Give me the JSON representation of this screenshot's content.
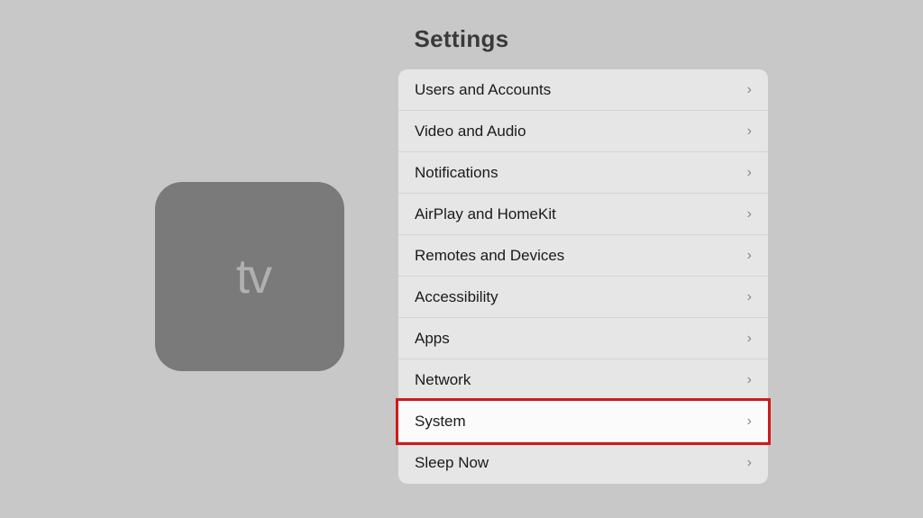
{
  "page": {
    "title": "Settings"
  },
  "device": {
    "label": "Apple TV",
    "apple_symbol": "",
    "tv_text": "tv"
  },
  "menu": {
    "items": [
      {
        "id": "users-and-accounts",
        "label": "Users and Accounts",
        "selected": false
      },
      {
        "id": "video-and-audio",
        "label": "Video and Audio",
        "selected": false
      },
      {
        "id": "notifications",
        "label": "Notifications",
        "selected": false
      },
      {
        "id": "airplay-and-homekit",
        "label": "AirPlay and HomeKit",
        "selected": false
      },
      {
        "id": "remotes-and-devices",
        "label": "Remotes and Devices",
        "selected": false
      },
      {
        "id": "accessibility",
        "label": "Accessibility",
        "selected": false
      },
      {
        "id": "apps",
        "label": "Apps",
        "selected": false
      },
      {
        "id": "network",
        "label": "Network",
        "selected": false
      },
      {
        "id": "system",
        "label": "System",
        "selected": true
      },
      {
        "id": "sleep-now",
        "label": "Sleep Now",
        "selected": false
      }
    ],
    "chevron": "›"
  }
}
